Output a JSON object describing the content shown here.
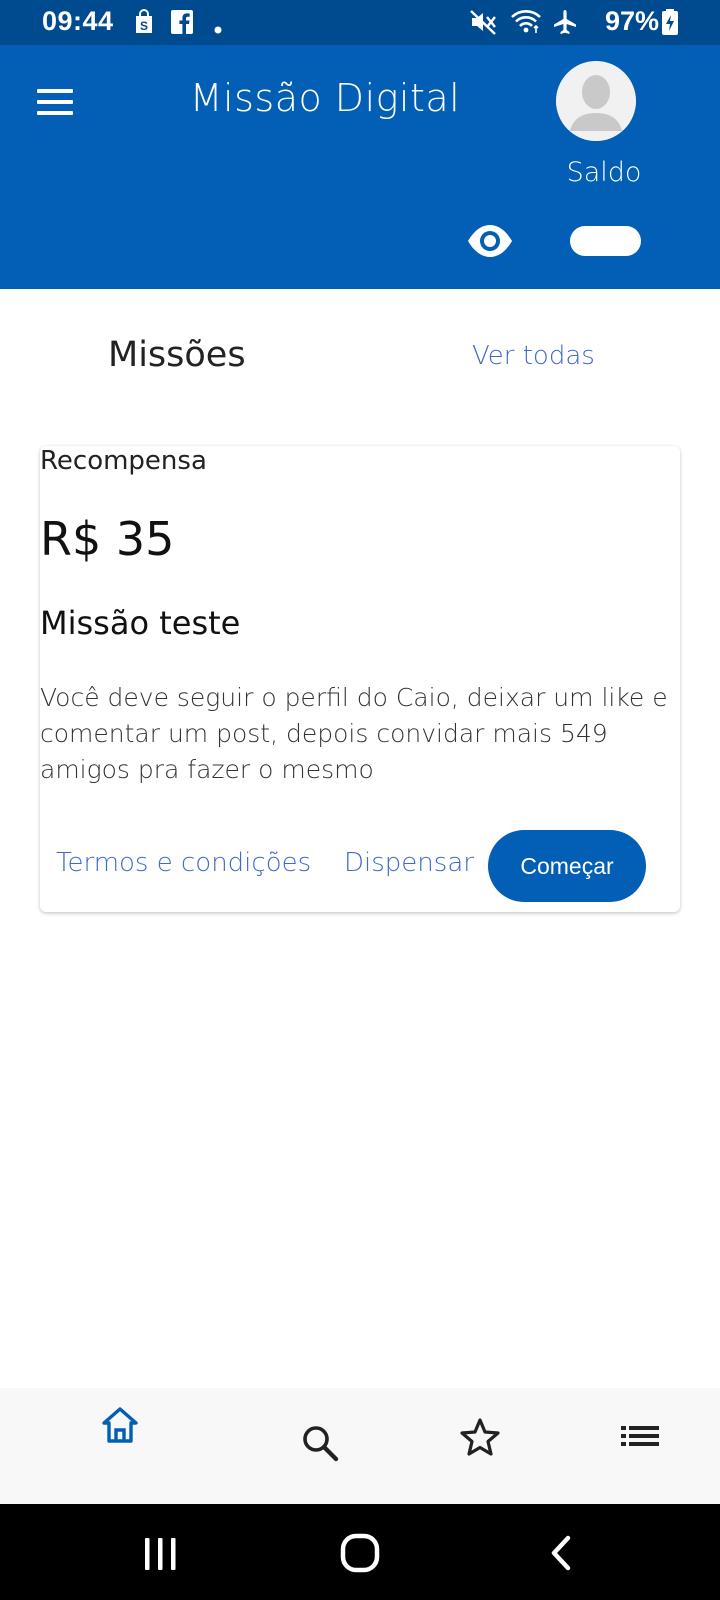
{
  "status_bar": {
    "time": "09:44",
    "battery_percent": "97%",
    "left_icons": [
      "shopping-bag-icon",
      "facebook-icon",
      "notification-dot-icon"
    ],
    "right_icons": [
      "mute-icon",
      "wifi-icon",
      "airplane-mode-icon",
      "battery-charging-icon"
    ]
  },
  "header": {
    "title": "Missão Digital",
    "balance_label": "Saldo",
    "colors": {
      "header_bg": "#025fb5",
      "status_bg": "#004a8f"
    }
  },
  "missions_section": {
    "title": "Missões",
    "see_all": "Ver todas"
  },
  "mission_card": {
    "reward_label": "Recompensa",
    "reward_value": "R$ 35",
    "title": "Missão teste",
    "description": "Você deve seguir o perfil do Caio, deixar um like e comentar um post, depois convidar mais 549 amigos pra fazer o mesmo",
    "terms_label": "Termos e condições",
    "dismiss_label": "Dispensar",
    "start_label": "Começar"
  },
  "bottom_nav": {
    "items": [
      {
        "icon": "home-icon",
        "active": true
      },
      {
        "icon": "search-icon",
        "active": false
      },
      {
        "icon": "star-icon",
        "active": false
      },
      {
        "icon": "list-icon",
        "active": false
      }
    ],
    "active_color": "#025fb5"
  },
  "system_nav": [
    "recent-apps-icon",
    "home-circle-icon",
    "back-icon"
  ]
}
